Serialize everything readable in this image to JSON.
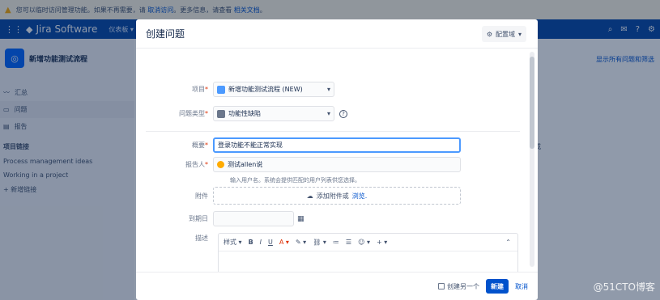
{
  "banner": {
    "text": "您可以临时访问管理功能。如果不再需要，请",
    "link1": "取消访问",
    "text2": "。更多信息，请查看",
    "link2": "相关文档",
    "text3": "。"
  },
  "nav": {
    "brand": "Jira Software",
    "menu": [
      "仪表板 ▾",
      "项"
    ]
  },
  "sidebar": {
    "project_name": "新增功能测试流程",
    "items": [
      {
        "label": "汇总"
      },
      {
        "label": "问题"
      },
      {
        "label": "报告"
      }
    ],
    "section_title": "项目链接",
    "links": [
      "Process management ideas",
      "Working in a project"
    ],
    "add_link": "+ 新增链接"
  },
  "main": {
    "right_link": "显示所有问题和筛选",
    "right_text": "或"
  },
  "dialog": {
    "title": "创建问题",
    "config_label": "配置域",
    "fields": {
      "project_label": "项目",
      "project_value": "新增功能测试流程 (NEW)",
      "type_label": "问题类型",
      "type_value": "功能性缺陷",
      "summary_label": "概要",
      "summary_value": "登录功能不能正常实现",
      "reporter_label": "报告人",
      "reporter_value": "测试allen说",
      "reporter_hint": "输入用户名。系统会提供匹配的用户列表供您选择。",
      "attachment_label": "附件",
      "attachment_text": "添加附件或",
      "attachment_browse": "浏览.",
      "duedate_label": "到期日",
      "description_label": "描述"
    },
    "editor": {
      "style": "样式",
      "bold": "B",
      "italic": "I",
      "underline": "U",
      "color": "A"
    },
    "footer": {
      "create_another": "创建另一个",
      "create": "新建",
      "cancel": "取消"
    }
  },
  "watermark": "@51CTO博客"
}
